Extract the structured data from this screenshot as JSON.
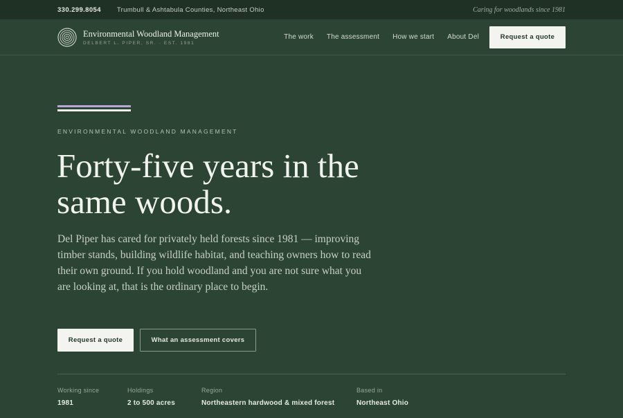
{
  "topbar": {
    "phone": "330.299.8054",
    "region": "Trumbull & Ashtabula Counties, Northeast Ohio",
    "tagline": "Caring for woodlands since 1981"
  },
  "brand": {
    "name": "Environmental Woodland Management",
    "subtitle": "DELBERT L. PIPER, SR. · EST. 1981",
    "logo_icon": "tree-ring-icon"
  },
  "nav": {
    "items": [
      {
        "label": "The work"
      },
      {
        "label": "The assessment"
      },
      {
        "label": "How we start"
      },
      {
        "label": "About Del"
      }
    ],
    "cta_label": "Request a quote"
  },
  "hero": {
    "eyebrow": "ENVIRONMENTAL WOODLAND MANAGEMENT",
    "headline": "Forty-five years in the same woods.",
    "lede": "Del Piper has cared for privately held forests since 1981 — improving timber stands, building wildlife habitat, and teaching owners how to read their own ground. If you hold woodland and you are not sure what you are looking at, that is the ordinary place to begin.",
    "primary_label": "Request a quote",
    "secondary_label": "What an assessment covers"
  },
  "stats": [
    {
      "label": "Working since",
      "value": "1981"
    },
    {
      "label": "Holdings",
      "value": "2 to 500 acres"
    },
    {
      "label": "Region",
      "value": "Northeastern hardwood & mixed forest"
    },
    {
      "label": "Based in",
      "value": "Northeast Ohio"
    }
  ],
  "colors": {
    "background": "#2c4433",
    "topbar": "#1f3124",
    "accent_lavender": "#b9a8d6",
    "button_light": "#f3f4ef"
  }
}
